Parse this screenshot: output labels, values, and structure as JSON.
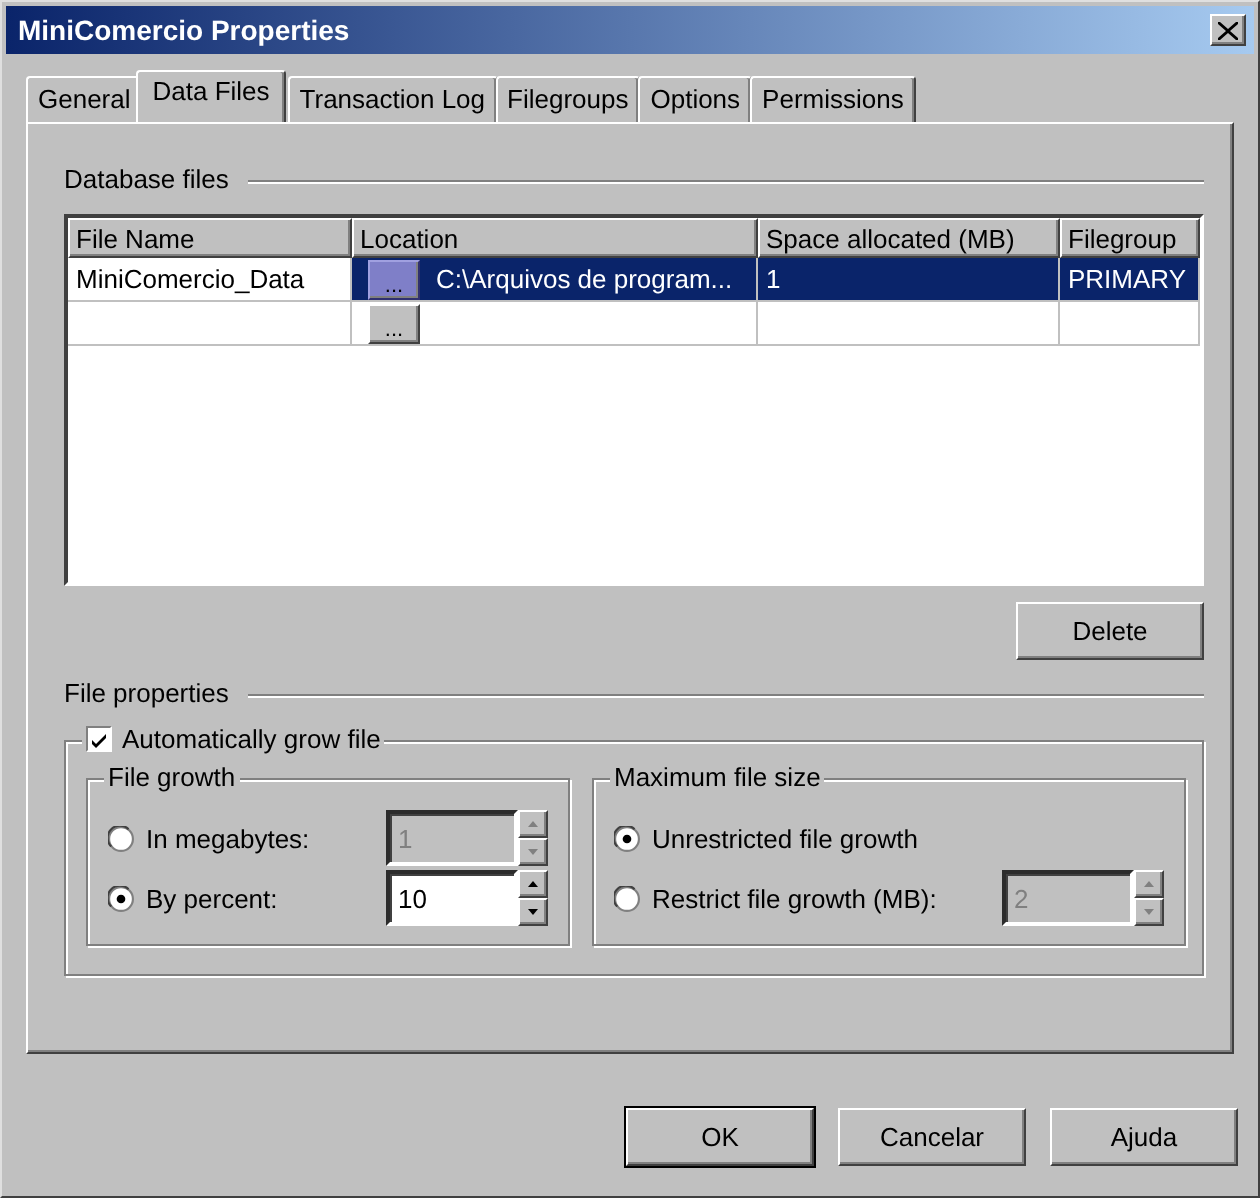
{
  "window": {
    "title": "MiniComercio Properties"
  },
  "tabs": [
    {
      "label": "General",
      "selected": false
    },
    {
      "label": "Data Files",
      "selected": true
    },
    {
      "label": "Transaction Log",
      "selected": false
    },
    {
      "label": "Filegroups",
      "selected": false
    },
    {
      "label": "Options",
      "selected": false
    },
    {
      "label": "Permissions",
      "selected": false
    }
  ],
  "database_files": {
    "heading": "Database files",
    "columns": [
      "File Name",
      "Location",
      "Space allocated (MB)",
      "Filegroup"
    ],
    "rows": [
      {
        "file_name": "MiniComercio_Data",
        "browse_button": "...",
        "location": "C:\\Arquivos de program...",
        "space_allocated": "1",
        "filegroup": "PRIMARY",
        "selected": true
      },
      {
        "browse_button": "...",
        "selected": false
      }
    ],
    "delete_button": "Delete"
  },
  "file_properties": {
    "heading": "File properties",
    "auto_grow": {
      "label": "Automatically grow file",
      "checked": true
    },
    "file_growth": {
      "heading": "File growth",
      "options": [
        {
          "label": "In megabytes:",
          "selected": false,
          "value": "1"
        },
        {
          "label": "By percent:",
          "selected": true,
          "value": "10"
        }
      ]
    },
    "maximum_file_size": {
      "heading": "Maximum file size",
      "options": [
        {
          "label": "Unrestricted file growth",
          "selected": true
        },
        {
          "label": "Restrict file growth (MB):",
          "selected": false,
          "value": "2"
        }
      ]
    }
  },
  "buttons": [
    {
      "label": "OK",
      "default": true
    },
    {
      "label": "Cancelar",
      "default": false
    },
    {
      "label": "Ajuda",
      "default": false
    }
  ]
}
